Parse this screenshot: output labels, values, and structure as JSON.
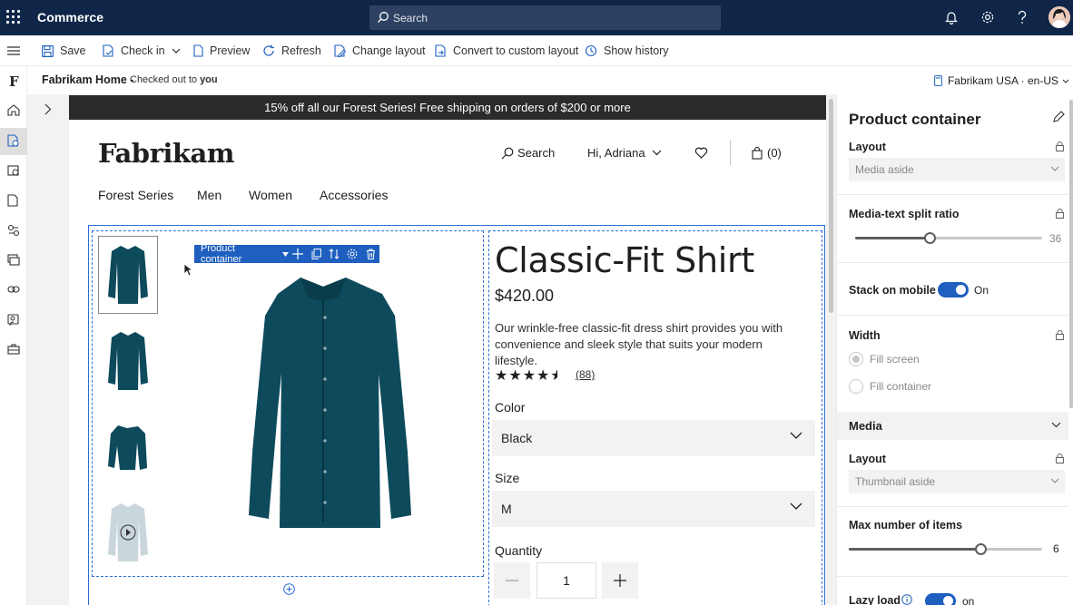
{
  "app": {
    "name": "Commerce",
    "search_placeholder": "Search"
  },
  "commands": {
    "save": "Save",
    "check_in": "Check in",
    "preview": "Preview",
    "refresh": "Refresh",
    "change_layout": "Change layout",
    "convert": "Convert to custom layout",
    "history": "Show history"
  },
  "breadcrumb": {
    "title": "Fabrikam Home -",
    "checked_out": "Checked out to",
    "user": "you",
    "locale": "Fabrikam USA · en-US"
  },
  "rail_logo": "F",
  "site": {
    "promo": "15% off all our Forest Series! Free shipping on orders of $200 or more",
    "logo": "Fabrikam",
    "search": "Search",
    "greeting": "Hi, Adriana",
    "cart": "(0)",
    "nav": [
      "Forest Series",
      "Men",
      "Women",
      "Accessories"
    ]
  },
  "product": {
    "toolbar_label": "Product container",
    "title": "Classic-Fit Shirt",
    "price": "$420.00",
    "description": "Our wrinkle-free classic-fit dress shirt provides you with convenience and sleek style that suits your modern lifestyle.",
    "stars": "★★★★",
    "rating": 4.5,
    "reviews": "(88)",
    "color_label": "Color",
    "color_value": "Black",
    "size_label": "Size",
    "size_value": "M",
    "quantity_label": "Quantity",
    "quantity_value": "1",
    "shirt_color": "#0d4a5c"
  },
  "panel": {
    "title": "Product container",
    "layout_label": "Layout",
    "layout_value": "Media aside",
    "split_label": "Media-text split ratio",
    "split_value": "36",
    "stack_label": "Stack on mobile",
    "stack_state": "On",
    "width_label": "Width",
    "width_options": [
      "Fill screen",
      "Fill container"
    ],
    "media_section": "Media",
    "media_layout_label": "Layout",
    "media_layout_value": "Thumbnail aside",
    "max_items_label": "Max number of items",
    "max_items_value": "6",
    "lazy_label": "Lazy load",
    "lazy_state": "on"
  },
  "colors": {
    "topbar": "#0f2649",
    "accent": "#1e5fbf",
    "selection": "#2b6fd6"
  }
}
